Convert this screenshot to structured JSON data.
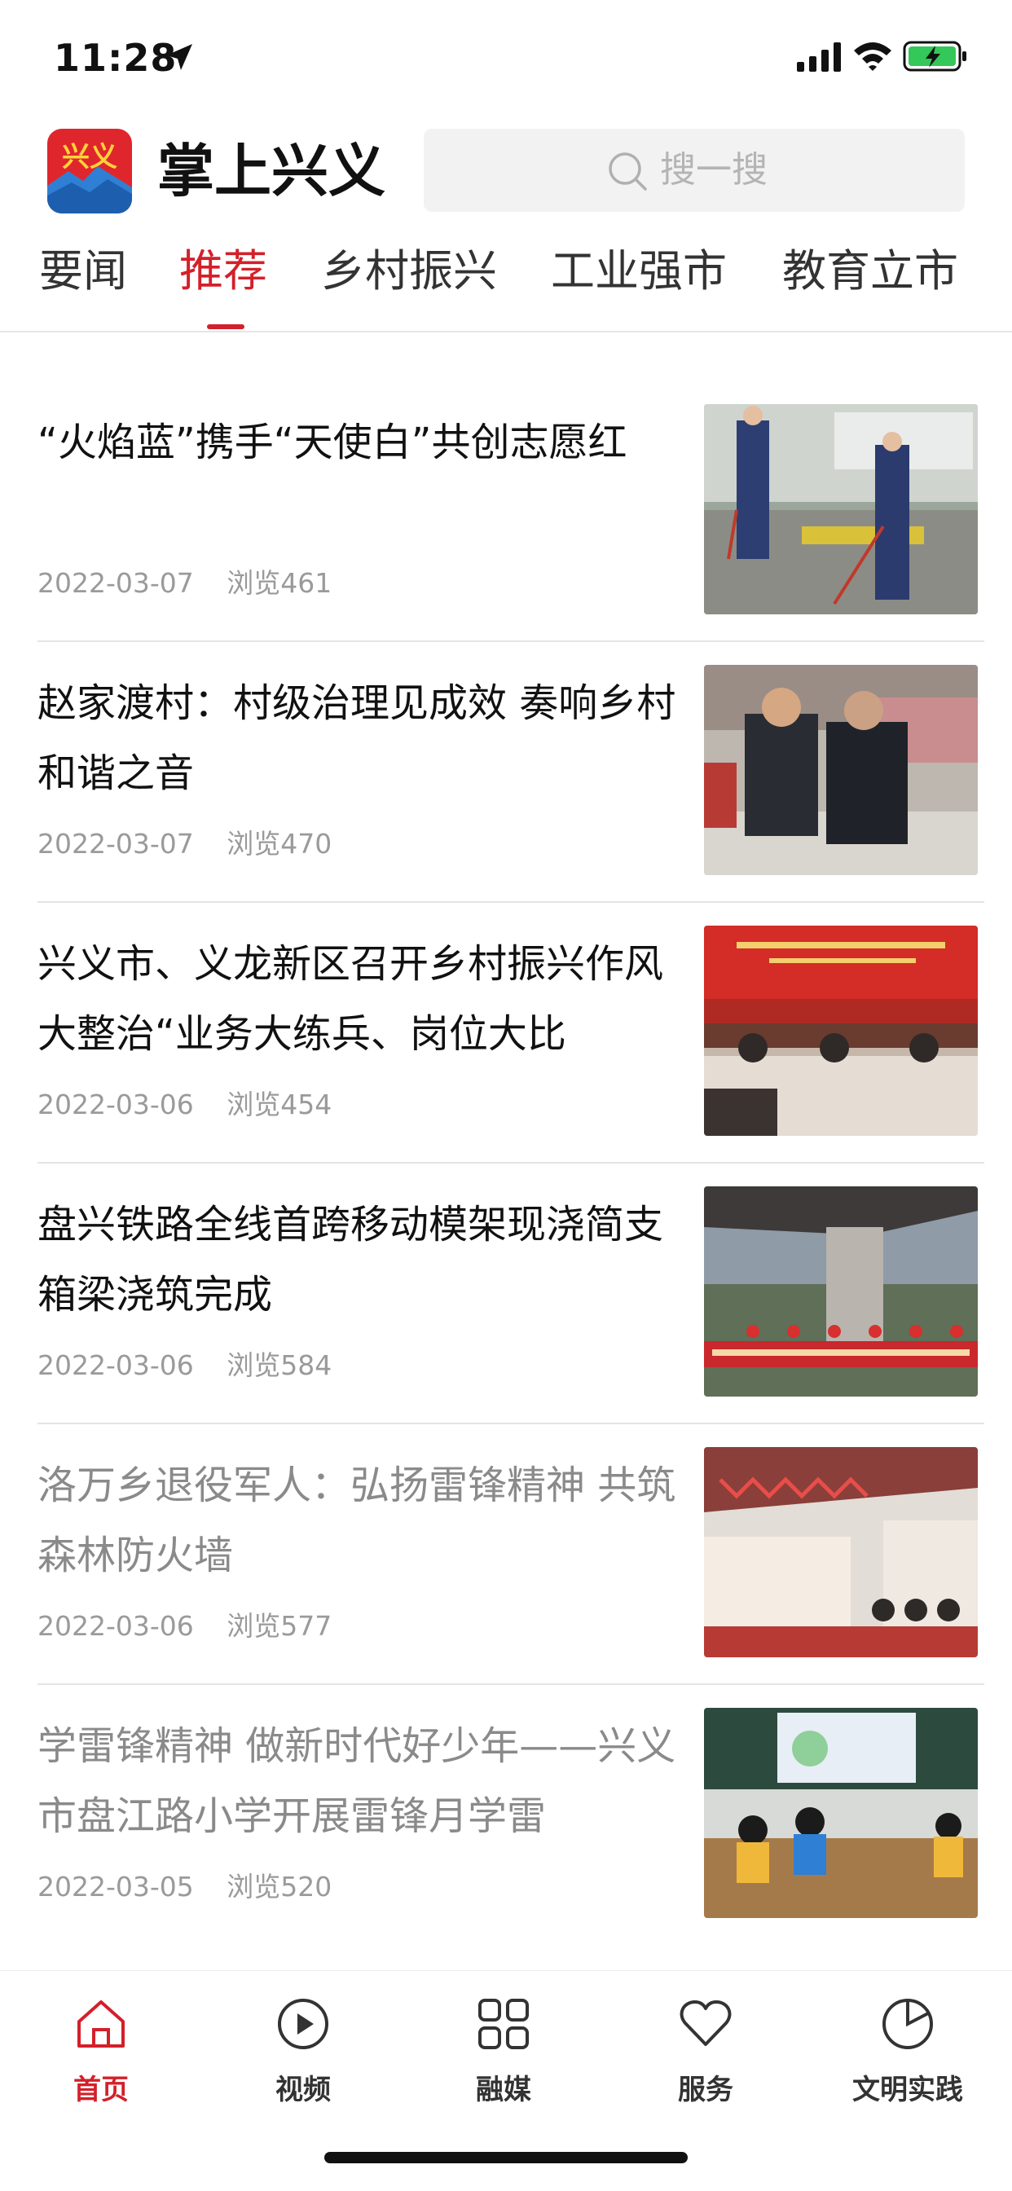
{
  "status_bar": {
    "time": "11:28"
  },
  "header": {
    "logo_text": "兴义",
    "app_title": "掌上兴义",
    "search_placeholder": "搜一搜"
  },
  "tabs": [
    {
      "label": "要闻"
    },
    {
      "label": "推荐",
      "active": true
    },
    {
      "label": "乡村振兴"
    },
    {
      "label": "工业强市"
    },
    {
      "label": "教育立市"
    }
  ],
  "articles": [
    {
      "title": "“火焰蓝”携手“天使白”共创志愿红",
      "date": "2022-03-07",
      "views": "浏览461",
      "read": false
    },
    {
      "title": "赵家渡村：村级治理见成效 奏响乡村和谐之音",
      "date": "2022-03-07",
      "views": "浏览470",
      "read": false
    },
    {
      "title": "兴义市、义龙新区召开乡村振兴作风大整治“业务大练兵、岗位大比",
      "date": "2022-03-06",
      "views": "浏览454",
      "read": false
    },
    {
      "title": "盘兴铁路全线首跨移动模架现浇简支箱梁浇筑完成",
      "date": "2022-03-06",
      "views": "浏览584",
      "read": false
    },
    {
      "title": "洛万乡退役军人：弘扬雷锋精神 共筑森林防火墙",
      "date": "2022-03-06",
      "views": "浏览577",
      "read": true
    },
    {
      "title": "学雷锋精神 做新时代好少年——兴义市盘江路小学开展雷锋月学雷",
      "date": "2022-03-05",
      "views": "浏览520",
      "read": true
    }
  ],
  "bottom_nav": [
    {
      "label": "首页",
      "icon": "home-icon",
      "active": true
    },
    {
      "label": "视频",
      "icon": "play-icon"
    },
    {
      "label": "融媒",
      "icon": "grid-icon"
    },
    {
      "label": "服务",
      "icon": "heart-icon"
    },
    {
      "label": "文明实践",
      "icon": "pie-icon"
    }
  ],
  "colors": {
    "accent": "#d3202a",
    "read_text": "#8a8a8a",
    "meta_text": "#9a9a9a"
  }
}
